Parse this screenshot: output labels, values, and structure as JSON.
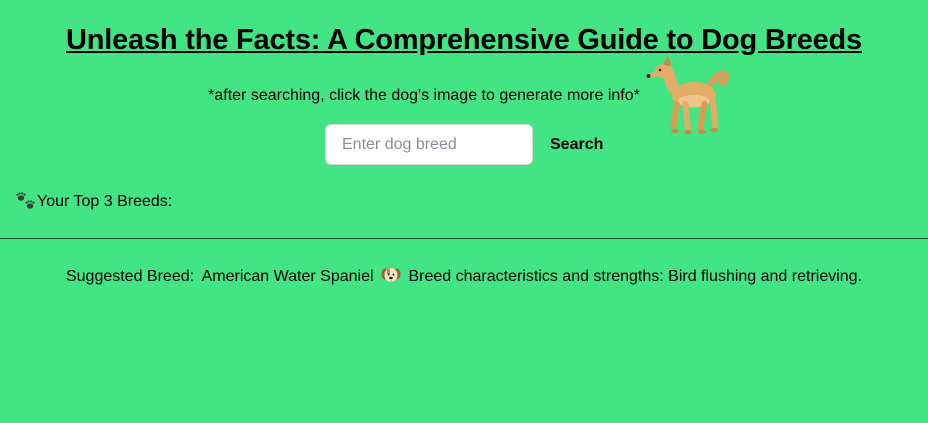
{
  "header": {
    "title": "Unleash the Facts: A Comprehensive Guide to Dog Breeds",
    "hint": "*after searching, click the dog's image to generate more info*",
    "dog_icon": "dog-emoji-icon"
  },
  "search": {
    "placeholder": "Enter dog breed",
    "value": "",
    "button_label": "Search"
  },
  "top_breeds": {
    "icon": "paw-prints-icon",
    "label": "Your Top 3 Breeds:",
    "items": []
  },
  "suggestion": {
    "label": "Suggested Breed:",
    "breed": "American Water Spaniel",
    "icon": "dog-face-icon",
    "characteristics_label": "Breed characteristics and strengths:",
    "characteristics": "Bird flushing and retrieving."
  },
  "colors": {
    "background": "#42e484",
    "text": "#000000",
    "input_border": "#d4d8dc"
  }
}
